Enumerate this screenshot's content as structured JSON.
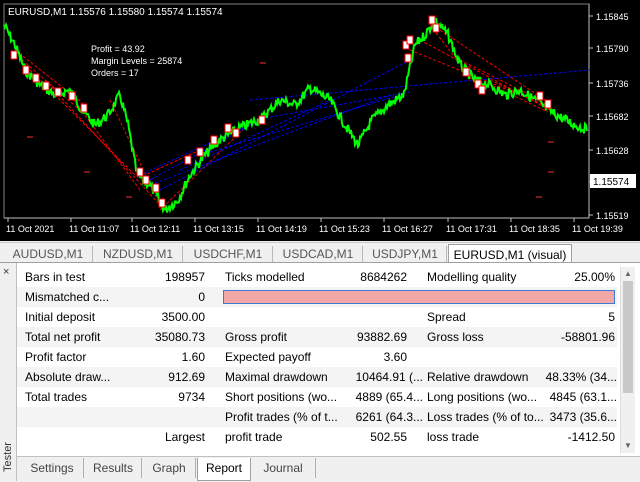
{
  "chart": {
    "title": "EURUSD,M1  1.15576 1.15580 1.15574 1.15574",
    "info_lines": [
      "Profit = 43.92",
      "Margin Levels = 25874",
      "Orders = 17"
    ],
    "price_labels": [
      "1.15845",
      "1.15790",
      "1.15736",
      "1.15682",
      "1.15628",
      "1.15574",
      "1.15519"
    ],
    "current_price": "1.15574",
    "time_labels": [
      "11 Oct 2021",
      "11 Oct 11:07",
      "11 Oct 12:11",
      "11 Oct 13:15",
      "11 Oct 14:19",
      "11 Oct 15:23",
      "11 Oct 16:27",
      "11 Oct 17:31",
      "11 Oct 18:35",
      "11 Oct 19:39"
    ],
    "colors": {
      "background": "#000000",
      "price": "#00ff00",
      "sell_line": "#ff0000",
      "buy_line": "#0000ff",
      "text": "#ffffff"
    }
  },
  "symbol_tabs": [
    "AUDUSD,M1",
    "NZDUSD,M1",
    "USDCHF,M1",
    "USDCAD,M1",
    "USDJPY,M1",
    "EURUSD,M1 (visual)"
  ],
  "active_symbol_tab": 5,
  "report": {
    "bars_label": "Bars in test",
    "bars_value": "198957",
    "ticks_label": "Ticks modelled",
    "ticks_value": "8684262",
    "quality_label": "Modelling quality",
    "quality_value": "25.00%",
    "mismatched_label": "Mismatched c...",
    "mismatched_value": "0",
    "deposit_label": "Initial deposit",
    "deposit_value": "3500.00",
    "spread_label": "Spread",
    "spread_value": "5",
    "netprofit_label": "Total net profit",
    "netprofit_value": "35080.73",
    "grossprofit_label": "Gross profit",
    "grossprofit_value": "93882.69",
    "grossloss_label": "Gross loss",
    "grossloss_value": "-58801.96",
    "pf_label": "Profit factor",
    "pf_value": "1.60",
    "payoff_label": "Expected payoff",
    "payoff_value": "3.60",
    "absdd_label": "Absolute draw...",
    "absdd_value": "912.69",
    "maxdd_label": "Maximal drawdown",
    "maxdd_value": "10464.91 (...",
    "reldd_label": "Relative drawdown",
    "reldd_value": "48.33% (34...",
    "trades_label": "Total trades",
    "trades_value": "9734",
    "short_label": "Short positions (wo...",
    "short_value": "4889 (65.4...",
    "long_label": "Long positions (wo...",
    "long_value": "4845 (63.1...",
    "ptrades_label": "Profit trades (% of t...",
    "ptrades_value": "6261 (64.3...",
    "ltrades_label": "Loss trades (% of to...",
    "ltrades_value": "3473 (35.6...",
    "largest_label": "Largest",
    "lprofit_label": "profit trade",
    "lprofit_value": "502.55",
    "lloss_label": "loss trade",
    "lloss_value": "-1412.50"
  },
  "bottom_tabs": [
    "Settings",
    "Results",
    "Graph",
    "Report",
    "Journal"
  ],
  "active_bottom_tab": 3,
  "side_label": "Tester",
  "side_close": "×"
}
